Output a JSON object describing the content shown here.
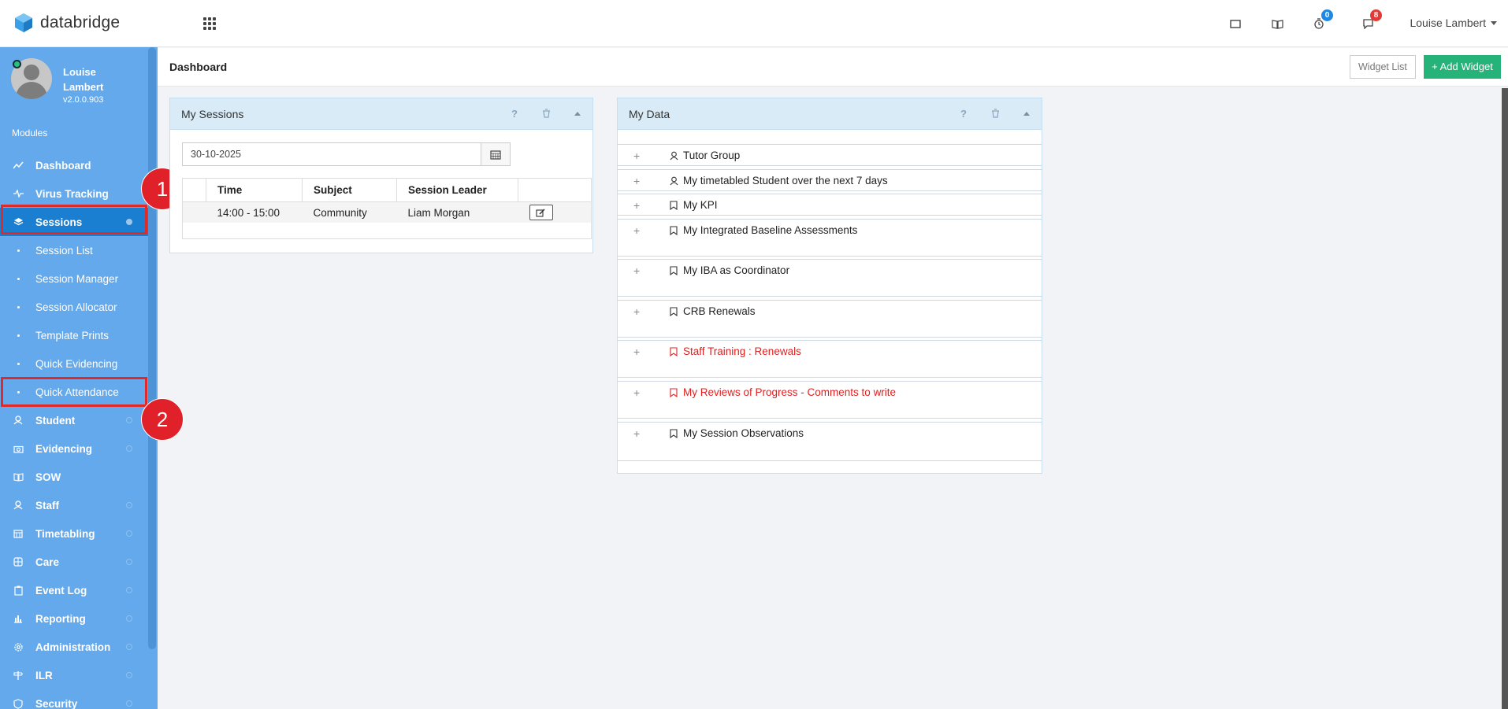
{
  "app": {
    "brand": "databridge"
  },
  "topbar": {
    "icons": [
      "window-icon",
      "book-icon",
      "timer-icon",
      "chat-icon"
    ],
    "timer_badge": "0",
    "chat_badge": "8",
    "user_name": "Louise Lambert"
  },
  "sidebar": {
    "profile": {
      "name": "Louise Lambert",
      "version": "v2.0.0.903"
    },
    "modules_label": "Modules",
    "items": [
      {
        "label": "Dashboard",
        "icon": "chart-line-icon"
      },
      {
        "label": "Virus Tracking",
        "icon": "heartbeat-icon"
      },
      {
        "label": "Sessions",
        "icon": "layers-icon"
      },
      {
        "label": "Student",
        "icon": "student-icon"
      },
      {
        "label": "Evidencing",
        "icon": "camera-icon"
      },
      {
        "label": "SOW",
        "icon": "book-icon"
      },
      {
        "label": "Staff",
        "icon": "staff-icon"
      },
      {
        "label": "Timetabling",
        "icon": "calendar-icon"
      },
      {
        "label": "Care",
        "icon": "care-icon"
      },
      {
        "label": "Event Log",
        "icon": "clipboard-icon"
      },
      {
        "label": "Reporting",
        "icon": "bar-chart-icon"
      },
      {
        "label": "Administration",
        "icon": "cog-icon"
      },
      {
        "label": "ILR",
        "icon": "signpost-icon"
      },
      {
        "label": "Security",
        "icon": "shield-icon"
      }
    ],
    "session_subitems": [
      "Session List",
      "Session Manager",
      "Session Allocator",
      "Template Prints",
      "Quick Evidencing",
      "Quick Attendance"
    ]
  },
  "annotations": {
    "marker1": "1",
    "marker2": "2"
  },
  "page": {
    "title": "Dashboard",
    "widget_list_label": "Widget List",
    "add_widget_label": "+ Add Widget"
  },
  "my_sessions": {
    "title": "My Sessions",
    "help": "?",
    "date": "30-10-2025",
    "columns": [
      "Time",
      "Subject",
      "Session Leader"
    ],
    "rows": [
      {
        "time": "14:00 - 15:00",
        "subject": "Community",
        "leader": "Liam Morgan"
      }
    ]
  },
  "my_data": {
    "title": "My Data",
    "help": "?",
    "items": [
      {
        "label": "Tutor Group",
        "icon": "user-icon",
        "color": "#222222"
      },
      {
        "label": "My timetabled Student over the next 7 days",
        "icon": "user-icon",
        "color": "#222222"
      },
      {
        "label": "My KPI",
        "icon": "bookmark-icon",
        "color": "#222222"
      },
      {
        "label": "My Integrated Baseline Assessments",
        "icon": "bookmark-icon",
        "color": "#222222"
      },
      {
        "label": "My IBA as Coordinator",
        "icon": "bookmark-icon",
        "color": "#222222"
      },
      {
        "label": "CRB Renewals",
        "icon": "bookmark-icon",
        "color": "#222222"
      },
      {
        "label": "Staff Training : Renewals",
        "icon": "bookmark-icon",
        "color": "#e02020"
      },
      {
        "label": "My Reviews of Progress - Comments to write",
        "icon": "bookmark-icon",
        "color": "#e02020"
      },
      {
        "label": "My Session Observations",
        "icon": "bookmark-icon",
        "color": "#222222"
      }
    ]
  }
}
